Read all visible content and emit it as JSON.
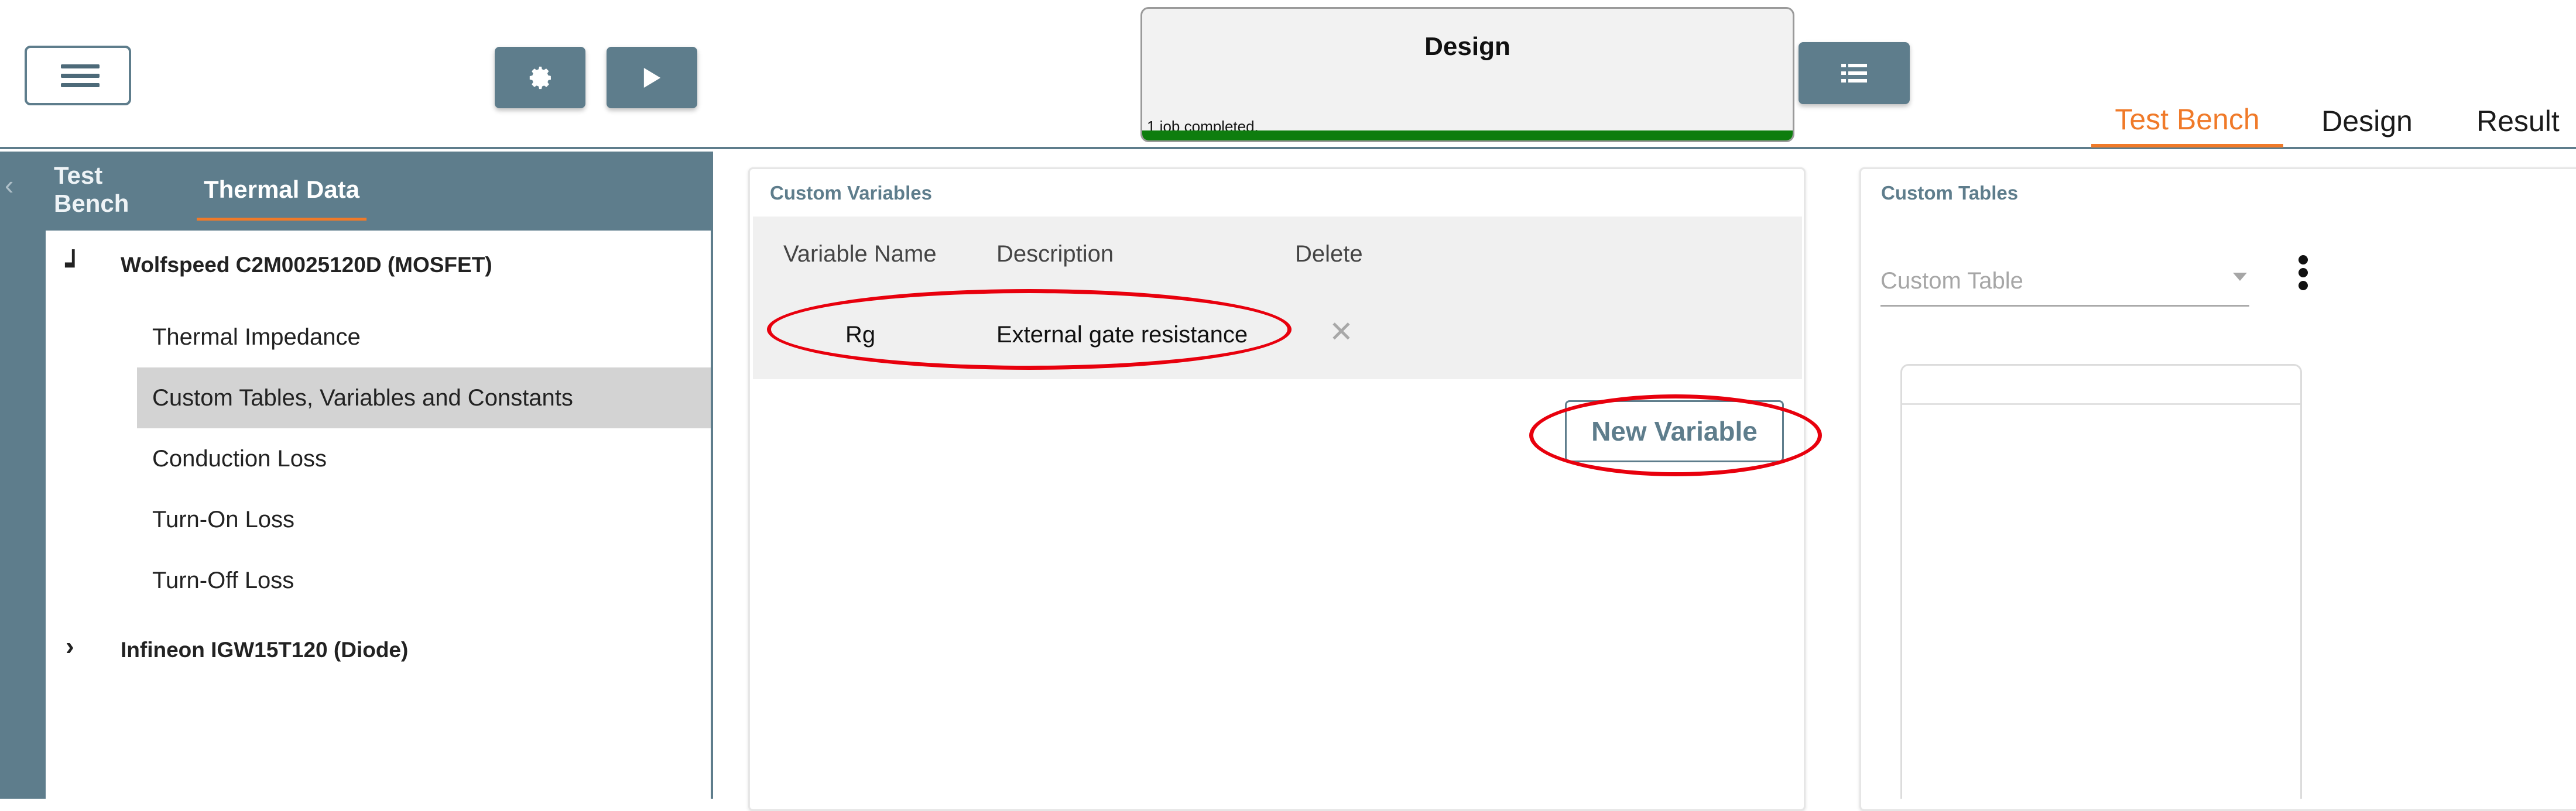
{
  "toolbar": {
    "menu_icon": "hamburger-menu-icon",
    "settings_icon": "gear-icon",
    "run_icon": "play-icon",
    "list_icon": "list-icon"
  },
  "job": {
    "title": "Design",
    "status": "1 job completed.",
    "progress": 1.0
  },
  "main_tabs": [
    {
      "label": "Test Bench",
      "active": true
    },
    {
      "label": "Design",
      "active": false
    },
    {
      "label": "Result",
      "active": false
    }
  ],
  "sidebar": {
    "back_icon": "chevron-left-icon",
    "tabs": [
      {
        "label": "Test Bench",
        "active": false
      },
      {
        "label": "Thermal Data",
        "active": true
      }
    ],
    "tree": [
      {
        "label": "Wolfspeed C2M0025120D (MOSFET)",
        "expanded": true,
        "children": [
          "Thermal Impedance",
          "Custom Tables, Variables and Constants",
          "Conduction Loss",
          "Turn-On Loss",
          "Turn-Off Loss"
        ],
        "selected_child": 1
      },
      {
        "label": "Infineon IGW15T120 (Diode)",
        "expanded": false
      }
    ]
  },
  "custom_variables": {
    "heading": "Custom Variables",
    "columns": [
      "Variable Name",
      "Description",
      "Delete"
    ],
    "rows": [
      {
        "name": "Rg",
        "description": "External gate resistance",
        "delete_icon": "close-icon"
      }
    ],
    "new_button": "New Variable"
  },
  "custom_tables": {
    "heading": "Custom Tables",
    "select_placeholder": "Custom Table",
    "more_icon": "kebab-menu-icon"
  },
  "colors": {
    "accent": "#f07a29",
    "primary": "#5e7d8c",
    "progress": "#0e7d0e",
    "annotation": "#e8000d"
  }
}
